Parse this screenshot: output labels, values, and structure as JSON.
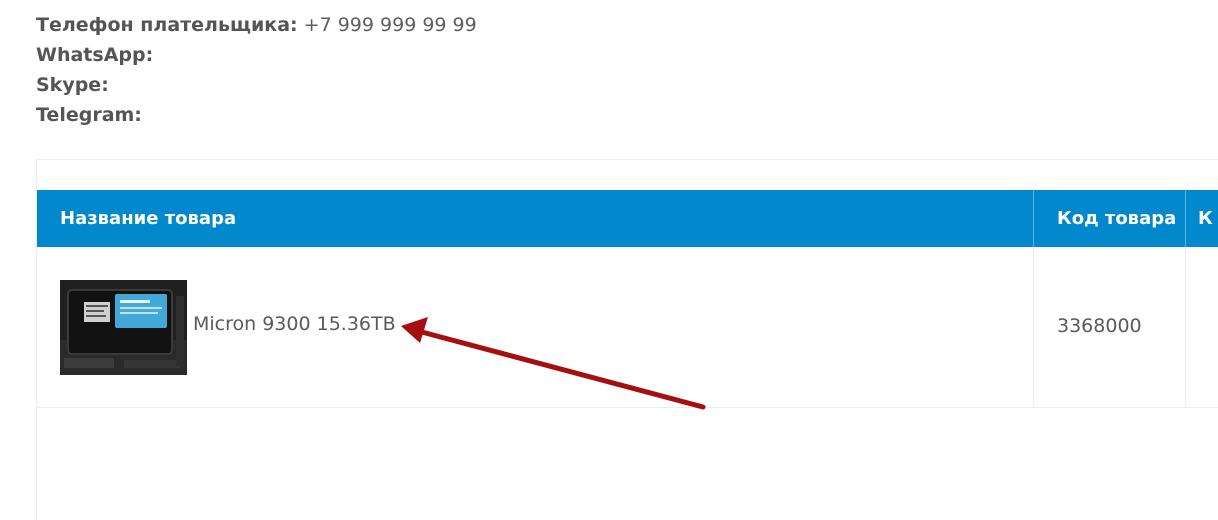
{
  "payer_info": {
    "phone_label": "Телефон плательщика:",
    "phone_value": "+7 999 999 99 99",
    "whatsapp_label": "WhatsApp:",
    "skype_label": "Skype:",
    "telegram_label": "Telegram:"
  },
  "table": {
    "headers": {
      "name": "Название товара",
      "code": "Код товара",
      "extra": "К"
    },
    "rows": [
      {
        "name": "Micron 9300 15.36TB",
        "code": "3368000",
        "image_icon": "ssd-product-photo"
      }
    ]
  },
  "colors": {
    "header_bg": "#0288cc",
    "annotation_arrow": "#a50f0f"
  }
}
